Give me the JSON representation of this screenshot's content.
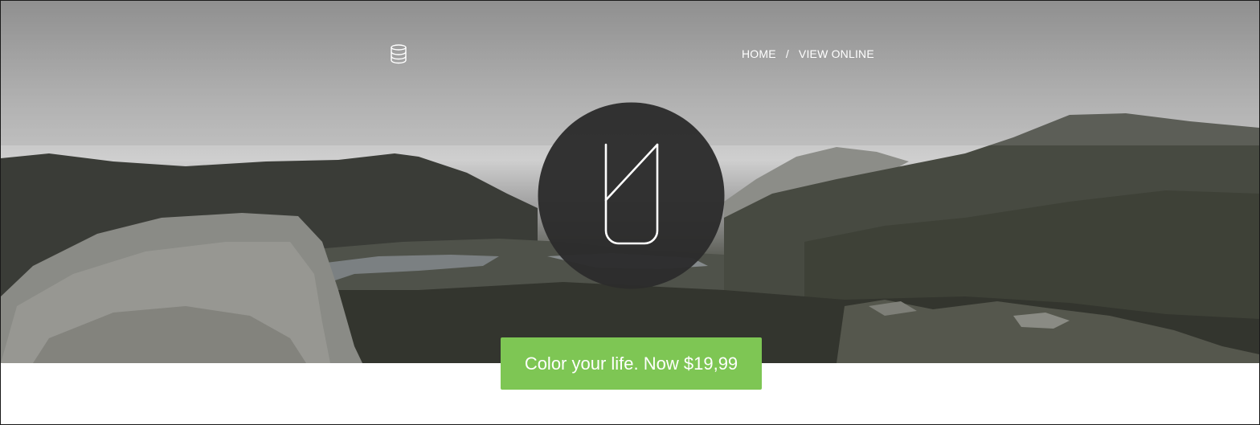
{
  "header": {
    "logo_icon": "database-icon",
    "nav": {
      "home_label": "HOME",
      "separator": "/",
      "view_online_label": "VIEW ONLINE"
    }
  },
  "hero": {
    "logo_mark": "brand-logo-icon"
  },
  "cta": {
    "label": "Color your life. Now $19,99",
    "color": "#7ec654"
  },
  "colors": {
    "logo_circle": "#2c2c2c",
    "text": "#ffffff"
  }
}
